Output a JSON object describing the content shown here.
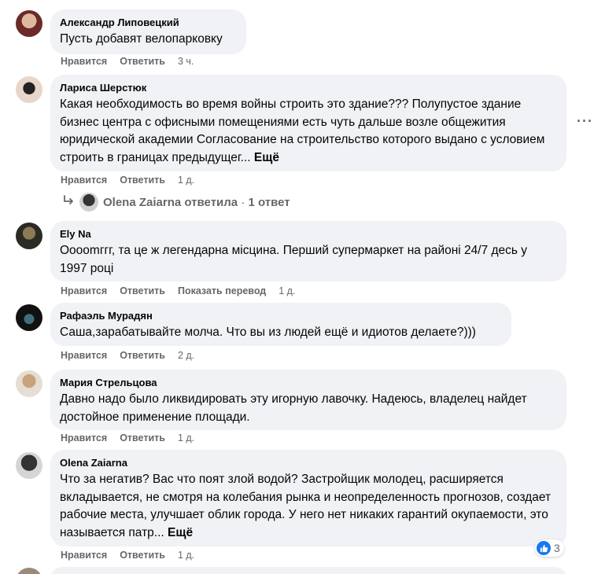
{
  "comments": [
    {
      "author": "Александр Липовецкий",
      "text": "Пусть добавят велопарковку",
      "like": "Нравится",
      "reply": "Ответить",
      "time": "3 ч."
    },
    {
      "author": "Лариса Шерстюк",
      "text": "Какая необходимость во время войны строить это здание??? Полупустое здание бизнес центра с офисными помещениями есть чуть дальше возле общежития юридической академии Согласование на строительство которого выдано с условием строить в границах предыдущег...",
      "more": "Ещё",
      "like": "Нравится",
      "reply": "Ответить",
      "time": "1 д.",
      "reply_summary": {
        "name": "Olena Zaiarna",
        "verb": "ответила",
        "sep": "·",
        "count": "1 ответ"
      }
    },
    {
      "author": "Ely Na",
      "text": "Ооооmггг, та це ж легендарна місцина. Перший супермаркет на районі 24/7 десь у 1997 році",
      "like": "Нравится",
      "reply": "Ответить",
      "translate": "Показать перевод",
      "time": "1 д."
    },
    {
      "author": "Рафаэль Мурадян",
      "text": "Саша,зарабатывайте молча. Что вы из людей ещё и идиотов делаете?)))",
      "like": "Нравится",
      "reply": "Ответить",
      "time": "2 д."
    },
    {
      "author": "Мария Стрельцова",
      "text": "Давно надо было ликвидировать эту игорную лавочку. Надеюсь, владелец найдет достойное применение площади.",
      "like": "Нравится",
      "reply": "Ответить",
      "time": "1 д."
    },
    {
      "author": "Olena Zaiarna",
      "text": "Что за негатив? Вас что поят злой водой? Застройщик молодец, расширяется вкладывается, не смотря на колебания рынка и неопределенность прогнозов, создает рабочие места, улучшает облик города. У него нет никаких гарантий окупаемости, это называется патр...",
      "more": "Ещё",
      "like": "Нравится",
      "reply": "Ответить",
      "time": "1 д.",
      "reactions": "3"
    }
  ],
  "colors": {
    "bubble": "#f0f2f5",
    "meta": "#65676b",
    "like_blue": "#1877f2"
  },
  "icons": [
    "reply-arrow-icon",
    "more-options-icon",
    "like-reaction-icon"
  ]
}
